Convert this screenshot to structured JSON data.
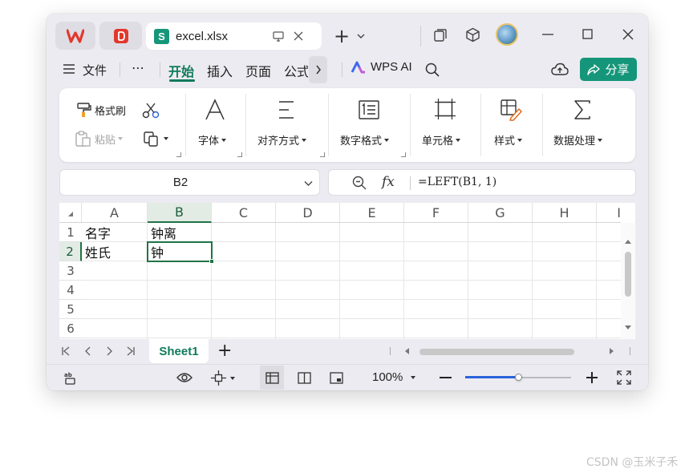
{
  "titlebar": {
    "tab_title": "excel.xlsx",
    "new_tab": "+"
  },
  "menu": {
    "file": "文件",
    "more": "⋯",
    "tabs": [
      "开始",
      "插入",
      "页面",
      "公式"
    ],
    "active_tab": "开始",
    "wps_ai": "WPS AI",
    "share": "分享"
  },
  "ribbon": {
    "format_painter": "格式刷",
    "paste": "粘贴",
    "font": "字体",
    "align": "对齐方式",
    "number_format": "数字格式",
    "cells": "单元格",
    "styles": "样式",
    "data": "数据处理"
  },
  "formula_bar": {
    "name_box": "B2",
    "fx": "fx",
    "formula": "=LEFT(B1, 1)"
  },
  "grid": {
    "columns": [
      "A",
      "B",
      "C",
      "D",
      "E",
      "F",
      "G",
      "H",
      "I"
    ],
    "rows": [
      "1",
      "2",
      "3",
      "4",
      "5",
      "6"
    ],
    "selected_cell": "B2",
    "cells": {
      "A1": "名字",
      "B1": "钟离",
      "A2": "姓氏",
      "B2": "钟"
    }
  },
  "sheets": {
    "tabs": [
      "Sheet1"
    ],
    "add": "+"
  },
  "statusbar": {
    "zoom": "100%",
    "zoom_fraction": 0.5
  },
  "watermark": "CSDN @玉米子禾",
  "colors": {
    "accent_green": "#0f7b5a",
    "selection_green": "#217346",
    "share_bg": "#15967a",
    "wps_red": "#e2382c",
    "slider_blue": "#2b63d9"
  }
}
